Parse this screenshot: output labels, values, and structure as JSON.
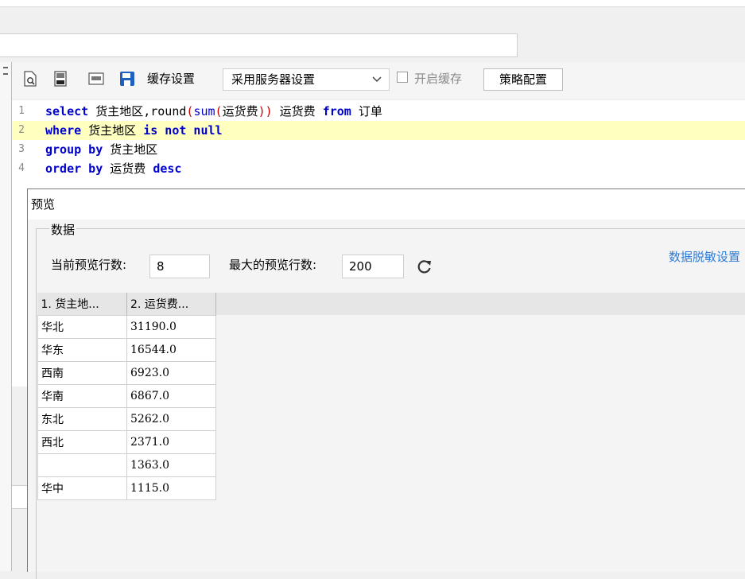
{
  "toolbar": {
    "cache_settings_label": "缓存设置",
    "cache_mode_value": "采用服务器设置",
    "enable_cache_label": "开启缓存",
    "enable_cache_checked": false,
    "strategy_button_label": "策略配置"
  },
  "editor": {
    "lines": [
      {
        "number": "1",
        "tokens": [
          [
            "kw",
            "select"
          ],
          [
            "txt",
            " 货主地区,round"
          ],
          [
            "op",
            "("
          ],
          [
            "fn",
            "sum"
          ],
          [
            "op",
            "("
          ],
          [
            "txt",
            "运货费"
          ],
          [
            "op",
            "))"
          ],
          [
            "txt",
            " 运货费 "
          ],
          [
            "kw",
            "from"
          ],
          [
            "txt",
            " 订单"
          ]
        ]
      },
      {
        "number": "2",
        "highlighted": true,
        "tokens": [
          [
            "kw",
            "where"
          ],
          [
            "txt",
            " 货主地区 "
          ],
          [
            "kw",
            "is not null"
          ]
        ]
      },
      {
        "number": "3",
        "tokens": [
          [
            "kw",
            "group by"
          ],
          [
            "txt",
            " 货主地区"
          ]
        ]
      },
      {
        "number": "4",
        "tokens": [
          [
            "kw",
            "order by"
          ],
          [
            "txt",
            " 运货费 "
          ],
          [
            "kw",
            "desc"
          ]
        ]
      }
    ]
  },
  "preview": {
    "title": "预览",
    "group_title": "数据",
    "current_rows_label": "当前预览行数:",
    "current_rows_value": "8",
    "max_rows_label": "最大的预览行数:",
    "max_rows_value": "200",
    "masking_link": "数据脱敏设置",
    "columns": [
      "1. 货主地...",
      "2. 运货费..."
    ],
    "rows": [
      [
        "华北",
        "31190.0"
      ],
      [
        "华东",
        "16544.0"
      ],
      [
        "西南",
        "6923.0"
      ],
      [
        "华南",
        "6867.0"
      ],
      [
        "东北",
        "5262.0"
      ],
      [
        "西北",
        "2371.0"
      ],
      [
        "",
        "1363.0"
      ],
      [
        "华中",
        "1115.0"
      ]
    ]
  },
  "colors": {
    "keyword": "#0000cc",
    "operator": "#cc0000",
    "highlight_line": "#ffffc0",
    "link": "#2e7bd6"
  }
}
